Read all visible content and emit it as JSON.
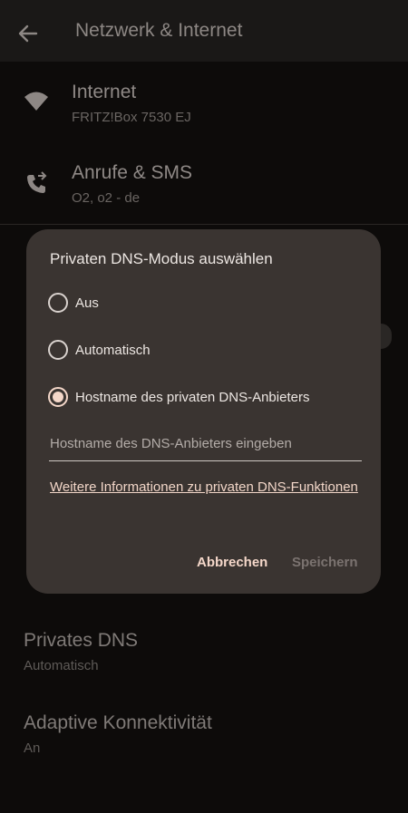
{
  "header": {
    "title": "Netzwerk & Internet",
    "back_icon": "arrow-back-icon"
  },
  "list": {
    "internet": {
      "title": "Internet",
      "subtitle": "FRITZ!Box 7530 EJ",
      "icon": "wifi-icon"
    },
    "calls": {
      "title": "Anrufe & SMS",
      "subtitle": "O2, o2 - de",
      "icon": "phone-forward-icon"
    }
  },
  "settings": {
    "private_dns": {
      "title": "Privates DNS",
      "subtitle": "Automatisch"
    },
    "adaptive": {
      "title": "Adaptive Konnektivität",
      "subtitle": "An"
    }
  },
  "dialog": {
    "title": "Privaten DNS-Modus auswählen",
    "options": [
      {
        "label": "Aus",
        "selected": false
      },
      {
        "label": "Automatisch",
        "selected": false
      },
      {
        "label": "Hostname des privaten DNS-Anbieters",
        "selected": true
      }
    ],
    "hostname_value": "",
    "hostname_placeholder": "Hostname des DNS-Anbieters eingeben",
    "info_link": "Weitere Informationen zu privaten DNS-Funktionen",
    "cancel_label": "Abbrechen",
    "save_label": "Speichern"
  },
  "colors": {
    "background": "#0d0b0a",
    "dialog": "#3a3431",
    "accent": "#f4d7c9"
  }
}
